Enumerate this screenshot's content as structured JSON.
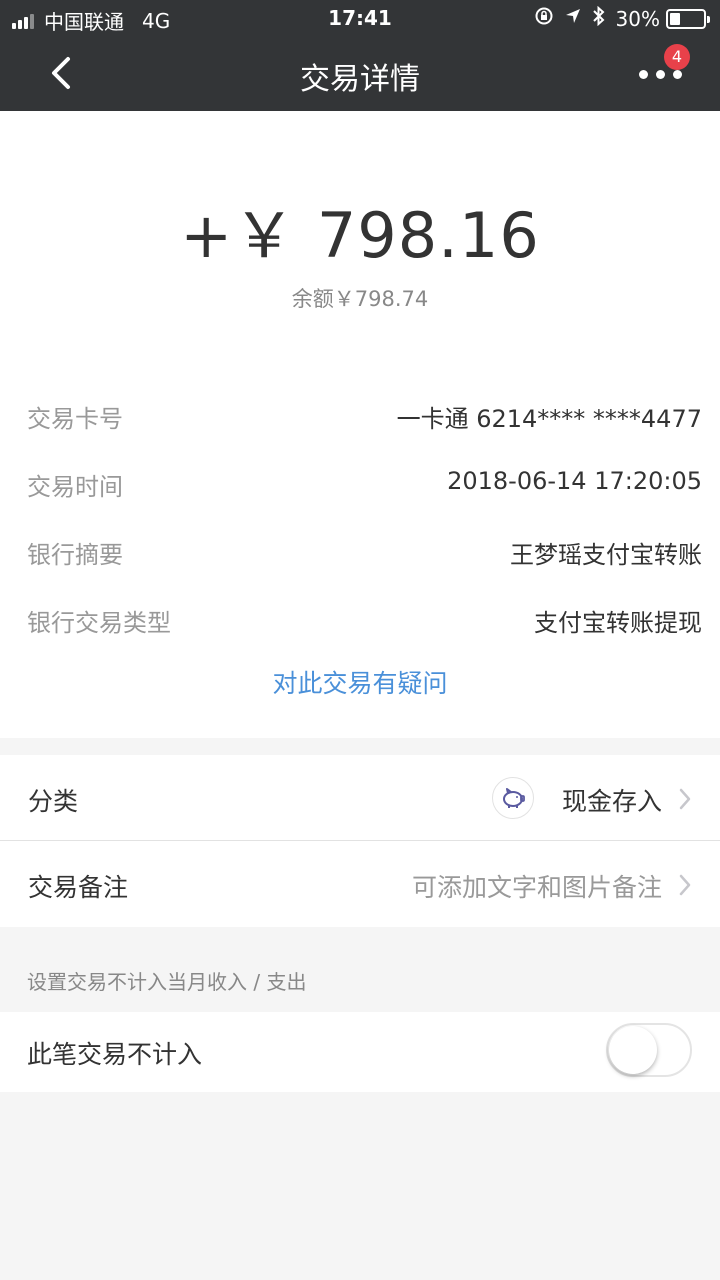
{
  "status_bar": {
    "carrier": "中国联通",
    "network": "4G",
    "time": "17:41",
    "battery_percent": "30%",
    "battery_level": 0.3
  },
  "nav": {
    "title": "交易详情",
    "badge_count": "4"
  },
  "transaction": {
    "amount": "+￥ 798.16",
    "balance": "余额￥798.74",
    "details": [
      {
        "label": "交易卡号",
        "value": "一卡通 6214**** ****4477"
      },
      {
        "label": "交易时间",
        "value": "2018-06-14 17:20:05"
      },
      {
        "label": "银行摘要",
        "value": "王梦瑶支付宝转账"
      },
      {
        "label": "银行交易类型",
        "value": "支付宝转账提现"
      }
    ],
    "question_link": "对此交易有疑问"
  },
  "category": {
    "label": "分类",
    "value": "现金存入",
    "icon": "piggy-bank-icon"
  },
  "note": {
    "label": "交易备注",
    "placeholder": "可添加文字和图片备注"
  },
  "exclude": {
    "section_label": "设置交易不计入当月收入 / 支出",
    "label": "此笔交易不计入",
    "enabled": false
  },
  "colors": {
    "header_bg": "#333537",
    "link": "#4a90d9",
    "badge": "#e8414a"
  }
}
